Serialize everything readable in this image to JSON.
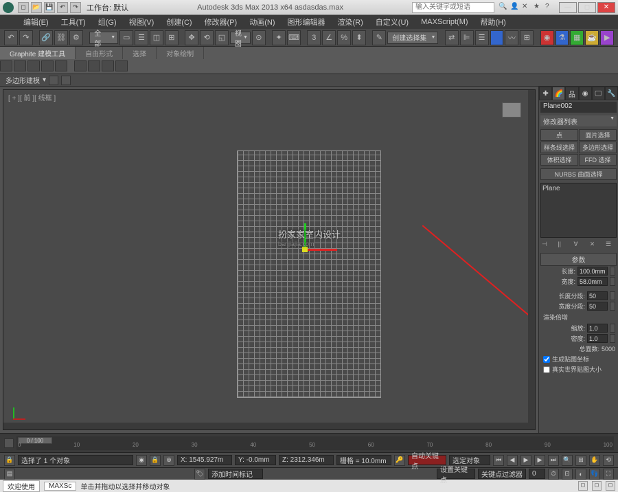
{
  "titlebar": {
    "workspace_label": "工作台: 默认",
    "title": "Autodesk 3ds Max  2013 x64    asdasdas.max",
    "search_placeholder": "输入关键字或短语"
  },
  "menu": {
    "items": [
      "编辑(E)",
      "工具(T)",
      "组(G)",
      "视图(V)",
      "创建(C)",
      "修改器(P)",
      "动画(N)",
      "图形编辑器",
      "渲染(R)",
      "自定义(U)",
      "MAXScript(M)",
      "帮助(H)"
    ]
  },
  "toolbar": {
    "selection_filter": "全部",
    "named_sel": "创建选择集"
  },
  "ribbon": {
    "tabs": [
      "Graphite 建模工具",
      "自由形式",
      "选择",
      "对象绘制"
    ],
    "poly_label": "多边形建模"
  },
  "viewport": {
    "label": "[ + ][ 前 ][ 线框 ]",
    "watermark": "扮家家室内设计",
    "watermark_sub": "banjiajia.com"
  },
  "cmd": {
    "object_name": "Plane002",
    "modifier_list": "修改器列表",
    "sel_buttons": [
      "点",
      "面片选择",
      "样条线选择",
      "多边形选择",
      "体积选择",
      "FFD 选择"
    ],
    "sel_wide": "NURBS 曲面选择",
    "stack_item": "Plane",
    "rollout_params": "参数",
    "length_label": "长度:",
    "length_val": "100.0mm",
    "width_label": "宽度:",
    "width_val": "58.0mm",
    "lseg_label": "长度分段:",
    "lseg_val": "50",
    "wseg_label": "宽度分段:",
    "wseg_val": "50",
    "render_head": "渲染倍增",
    "scale_label": "缩放:",
    "scale_val": "1.0",
    "density_label": "密度:",
    "density_val": "1.0",
    "total_label": "总面数:",
    "total_val": "5000",
    "gen_coords": "生成贴图坐标",
    "real_world": "真实世界贴图大小"
  },
  "timeline": {
    "frame_display": "0 / 100",
    "ticks": [
      "0",
      "10",
      "20",
      "30",
      "40",
      "50",
      "60",
      "70",
      "80",
      "90",
      "100"
    ]
  },
  "status": {
    "selected": "选择了 1 个对象",
    "x": "X: 1545.927m",
    "y": "Y: -0.0mm",
    "z": "Z: 2312.346m",
    "grid": "栅格 = 10.0mm",
    "autokey": "自动关键点",
    "selected_obj": "选定对象",
    "set_key": "设置关键点",
    "key_filter": "关键点过滤器",
    "add_time_tag": "添加时间标记"
  },
  "bottom": {
    "welcome": "欢迎使用",
    "script": "MAXSc",
    "hint": "单击并拖动以选择并移动对象"
  }
}
